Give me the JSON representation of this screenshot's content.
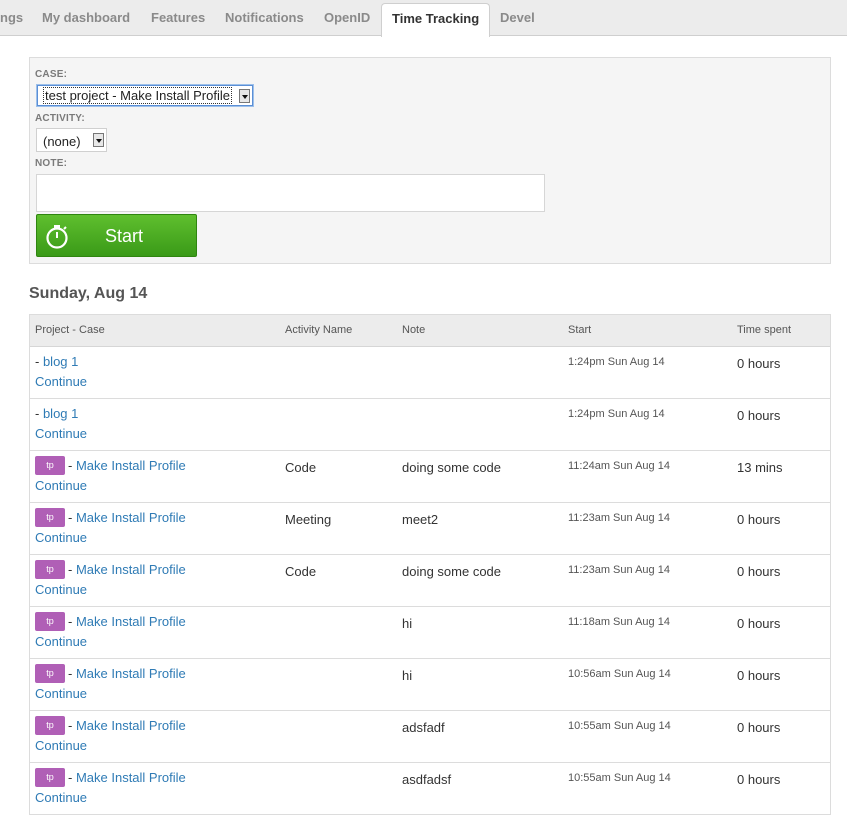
{
  "tabs": [
    {
      "label": "ngs",
      "active": false
    },
    {
      "label": "My dashboard",
      "active": false
    },
    {
      "label": "Features",
      "active": false
    },
    {
      "label": "Notifications",
      "active": false
    },
    {
      "label": "OpenID",
      "active": false
    },
    {
      "label": "Time Tracking",
      "active": true
    },
    {
      "label": "Devel",
      "active": false
    }
  ],
  "form": {
    "case_label": "CASE:",
    "case_value": "test project - Make Install Profile",
    "activity_label": "ACTIVITY:",
    "activity_value": "(none)",
    "note_label": "NOTE:",
    "note_value": "",
    "start_label": "Start",
    "start_icon": "stopwatch-icon",
    "start_color": "#4aab22"
  },
  "day_heading": "Sunday, Aug 14",
  "table": {
    "headers": [
      "Project - Case",
      "Activity Name",
      "Note",
      "Start",
      "Time spent"
    ],
    "continue_label": "Continue",
    "badge_color": "#b05fb6",
    "rows": [
      {
        "badge": "",
        "case": "blog 1",
        "activity": "",
        "note": "",
        "start": "1:24pm Sun Aug 14",
        "spent": "0 hours"
      },
      {
        "badge": "",
        "case": "blog 1",
        "activity": "",
        "note": "",
        "start": "1:24pm Sun Aug 14",
        "spent": "0 hours"
      },
      {
        "badge": "tp",
        "case": "Make Install Profile",
        "activity": "Code",
        "note": "doing some code",
        "start": "11:24am Sun Aug 14",
        "spent": "13 mins"
      },
      {
        "badge": "tp",
        "case": "Make Install Profile",
        "activity": "Meeting",
        "note": "meet2",
        "start": "11:23am Sun Aug 14",
        "spent": "0 hours"
      },
      {
        "badge": "tp",
        "case": "Make Install Profile",
        "activity": "Code",
        "note": "doing some code",
        "start": "11:23am Sun Aug 14",
        "spent": "0 hours"
      },
      {
        "badge": "tp",
        "case": "Make Install Profile",
        "activity": "",
        "note": "hi",
        "start": "11:18am Sun Aug 14",
        "spent": "0 hours"
      },
      {
        "badge": "tp",
        "case": "Make Install Profile",
        "activity": "",
        "note": "hi",
        "start": "10:56am Sun Aug 14",
        "spent": "0 hours"
      },
      {
        "badge": "tp",
        "case": "Make Install Profile",
        "activity": "",
        "note": "adsfadf",
        "start": "10:55am Sun Aug 14",
        "spent": "0 hours"
      },
      {
        "badge": "tp",
        "case": "Make Install Profile",
        "activity": "",
        "note": "asdfadsf",
        "start": "10:55am Sun Aug 14",
        "spent": "0 hours"
      }
    ]
  }
}
